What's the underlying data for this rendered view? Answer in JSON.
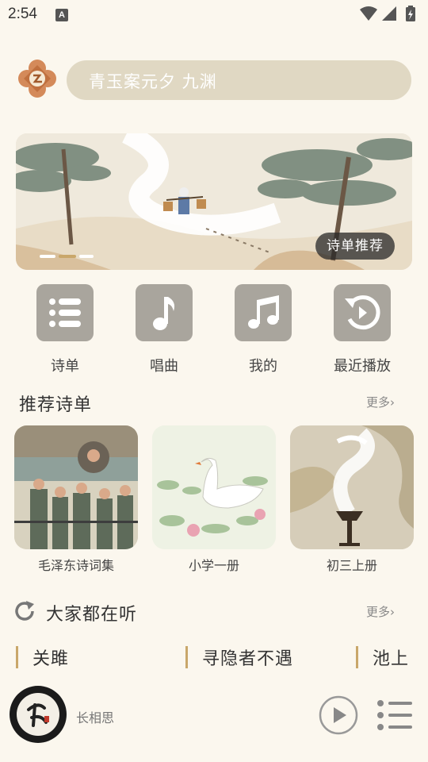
{
  "status_bar": {
    "time": "2:54",
    "notification_glyph": "A"
  },
  "header": {
    "search_placeholder": "青玉案元夕 九渊"
  },
  "banner": {
    "tag": "诗单推荐"
  },
  "quick_menu": [
    {
      "label": "诗单",
      "icon": "list-icon"
    },
    {
      "label": "唱曲",
      "icon": "music-note-icon"
    },
    {
      "label": "我的",
      "icon": "music-notes-icon"
    },
    {
      "label": "最近播放",
      "icon": "history-icon"
    }
  ],
  "recommended": {
    "title": "推荐诗单",
    "more": "更多",
    "items": [
      {
        "label": "毛泽东诗词集"
      },
      {
        "label": "小学一册"
      },
      {
        "label": "初三上册"
      }
    ]
  },
  "popular": {
    "title": "大家都在听",
    "more": "更多",
    "items": [
      "关雎",
      "寻隐者不遇",
      "池上"
    ]
  },
  "player": {
    "title": "长相思",
    "disc_text": "长相思"
  },
  "colors": {
    "background": "#fbf7ee",
    "accent": "#c9a76a",
    "icon_tile": "#a9a59d",
    "search_bg": "#e0d8c3"
  }
}
